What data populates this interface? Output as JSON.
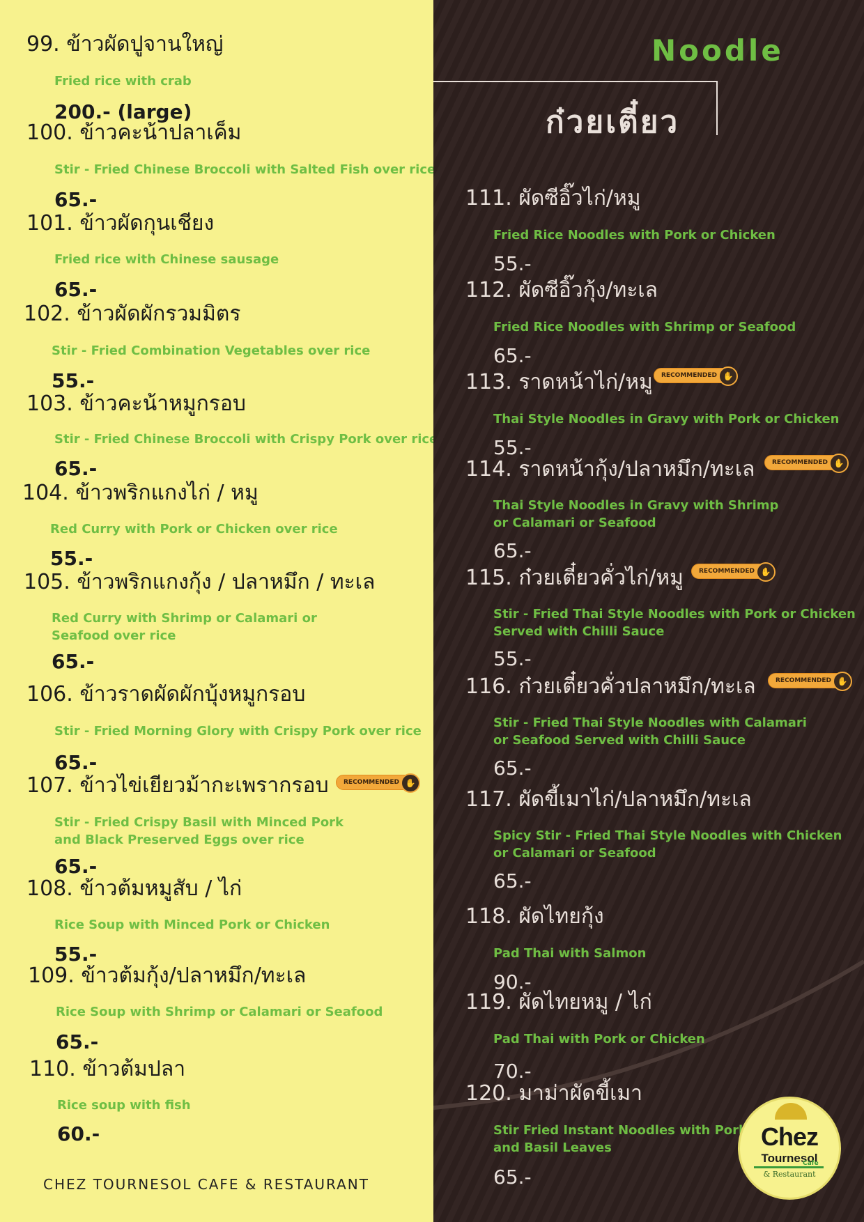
{
  "left_items": [
    {
      "name": "99. ข้าวผัดปูจานใหญ่",
      "desc": [
        "Fried rice with crab"
      ],
      "price": "200.- (large)"
    },
    {
      "name": "100. ข้าวคะน้าปลาเค็ม",
      "desc": [
        "Stir - Fried Chinese Broccoli with Salted Fish over rice"
      ],
      "price": "65.-"
    },
    {
      "name": "101. ข้าวผัดกุนเชียง",
      "desc": [
        "Fried rice with Chinese sausage"
      ],
      "price": "65.-"
    },
    {
      "name": "102. ข้าวผัดผักรวมมิตร",
      "desc": [
        "Stir - Fried Combination Vegetables over rice"
      ],
      "price": "55.-"
    },
    {
      "name": "103. ข้าวคะน้าหมูกรอบ",
      "desc": [
        "Stir - Fried Chinese Broccoli with Crispy Pork over rice"
      ],
      "price": "65.-"
    },
    {
      "name": "104. ข้าวพริกแกงไก่ / หมู",
      "desc": [
        "Red Curry with Pork or Chicken over rice"
      ],
      "price": "55.-"
    },
    {
      "name": "105. ข้าวพริกแกงกุ้ง / ปลาหมึก / ทะเล",
      "desc": [
        "Red Curry with Shrimp or Calamari or",
        "Seafood over rice"
      ],
      "price": "65.-"
    },
    {
      "name": "106. ข้าวราดผัดผักบุ้งหมูกรอบ",
      "desc": [
        "Stir - Fried Morning Glory with Crispy Pork over rice"
      ],
      "price": "65.-"
    },
    {
      "name": "107. ข้าวไข่เยียวม้ากะเพรากรอบ",
      "desc": [
        "Stir - Fried Crispy Basil with Minced Pork",
        "and Black Preserved Eggs over rice"
      ],
      "price": "65.-",
      "recommended": true
    },
    {
      "name": "108. ข้าวต้มหมูสับ / ไก่",
      "desc": [
        "Rice Soup with Minced Pork or Chicken"
      ],
      "price": "55.-"
    },
    {
      "name": "109. ข้าวต้มกุ้ง/ปลาหมึก/ทะเล",
      "desc": [
        "Rice Soup with Shrimp or Calamari or Seafood"
      ],
      "price": "65.-"
    },
    {
      "name": "110. ข้าวต้มปลา",
      "desc": [
        "Rice soup with fish"
      ],
      "price": "60.-"
    }
  ],
  "right_items": [
    {
      "name": "111. ผัดซีอิ๊วไก่/หมู",
      "desc": [
        "Fried Rice Noodles with Pork or Chicken"
      ],
      "price": "55.-"
    },
    {
      "name": "112. ผัดซีอิ๊วกุ้ง/ทะเล",
      "desc": [
        "Fried Rice Noodles with Shrimp or Seafood"
      ],
      "price": "65.-"
    },
    {
      "name": "113. ราดหน้าไก่/หมู",
      "desc": [
        "Thai Style Noodles in Gravy with Pork or Chicken"
      ],
      "price": "55.-",
      "recommended": true
    },
    {
      "name": "114. ราดหน้ากุ้ง/ปลาหมึก/ทะเล",
      "desc": [
        "Thai Style Noodles in Gravy with Shrimp",
        "or Calamari or Seafood"
      ],
      "price": "65.-",
      "recommended": true
    },
    {
      "name": "115. ก๋วยเตี๋ยวคั่วไก่/หมู",
      "desc": [
        "Stir - Fried Thai Style Noodles with Pork or Chicken",
        "Served with Chilli Sauce"
      ],
      "price": "55.-",
      "recommended": true
    },
    {
      "name": "116. ก๋วยเตี๋ยวคั่วปลาหมึก/ทะเล",
      "desc": [
        "Stir - Fried Thai Style Noodles with Calamari",
        "or Seafood Served with Chilli Sauce"
      ],
      "price": "65.-",
      "recommended": true
    },
    {
      "name": "117. ผัดขี้เมาไก่/ปลาหมึก/ทะเล",
      "desc": [
        "Spicy Stir - Fried Thai Style Noodles with Chicken",
        "or Calamari or Seafood"
      ],
      "price": "65.-"
    },
    {
      "name": "118. ผัดไทยกุ้ง",
      "desc": [
        "Pad Thai with Salmon"
      ],
      "price": "90.-"
    },
    {
      "name": "119. ผัดไทยหมู / ไก่",
      "desc": [
        "Pad Thai with Pork or Chicken"
      ],
      "price": "70.-"
    },
    {
      "name": "120. มาม่าผัดขี้เมา",
      "desc": [
        "Stir Fried Instant Noodles with Pork",
        "and Basil Leaves"
      ],
      "price": "65.-"
    }
  ],
  "recommended_label": "RECOMMENDED",
  "thumb_icon": "thumbs-up-icon",
  "section": {
    "title_en": "Noodle",
    "title_th": "ก๋วยเตี๋ยว"
  },
  "footer": "CHEZ TOURNESOL CAFE & RESTAURANT",
  "logo": {
    "line1": "Chez",
    "line2": "Tournesol",
    "line3": "Cafe",
    "line4": "& Restaurant"
  },
  "colors": {
    "left_bg": "#f7f28e",
    "right_bg": "#332523",
    "desc_green": "#6fbe44",
    "badge": "#f2a83a"
  }
}
